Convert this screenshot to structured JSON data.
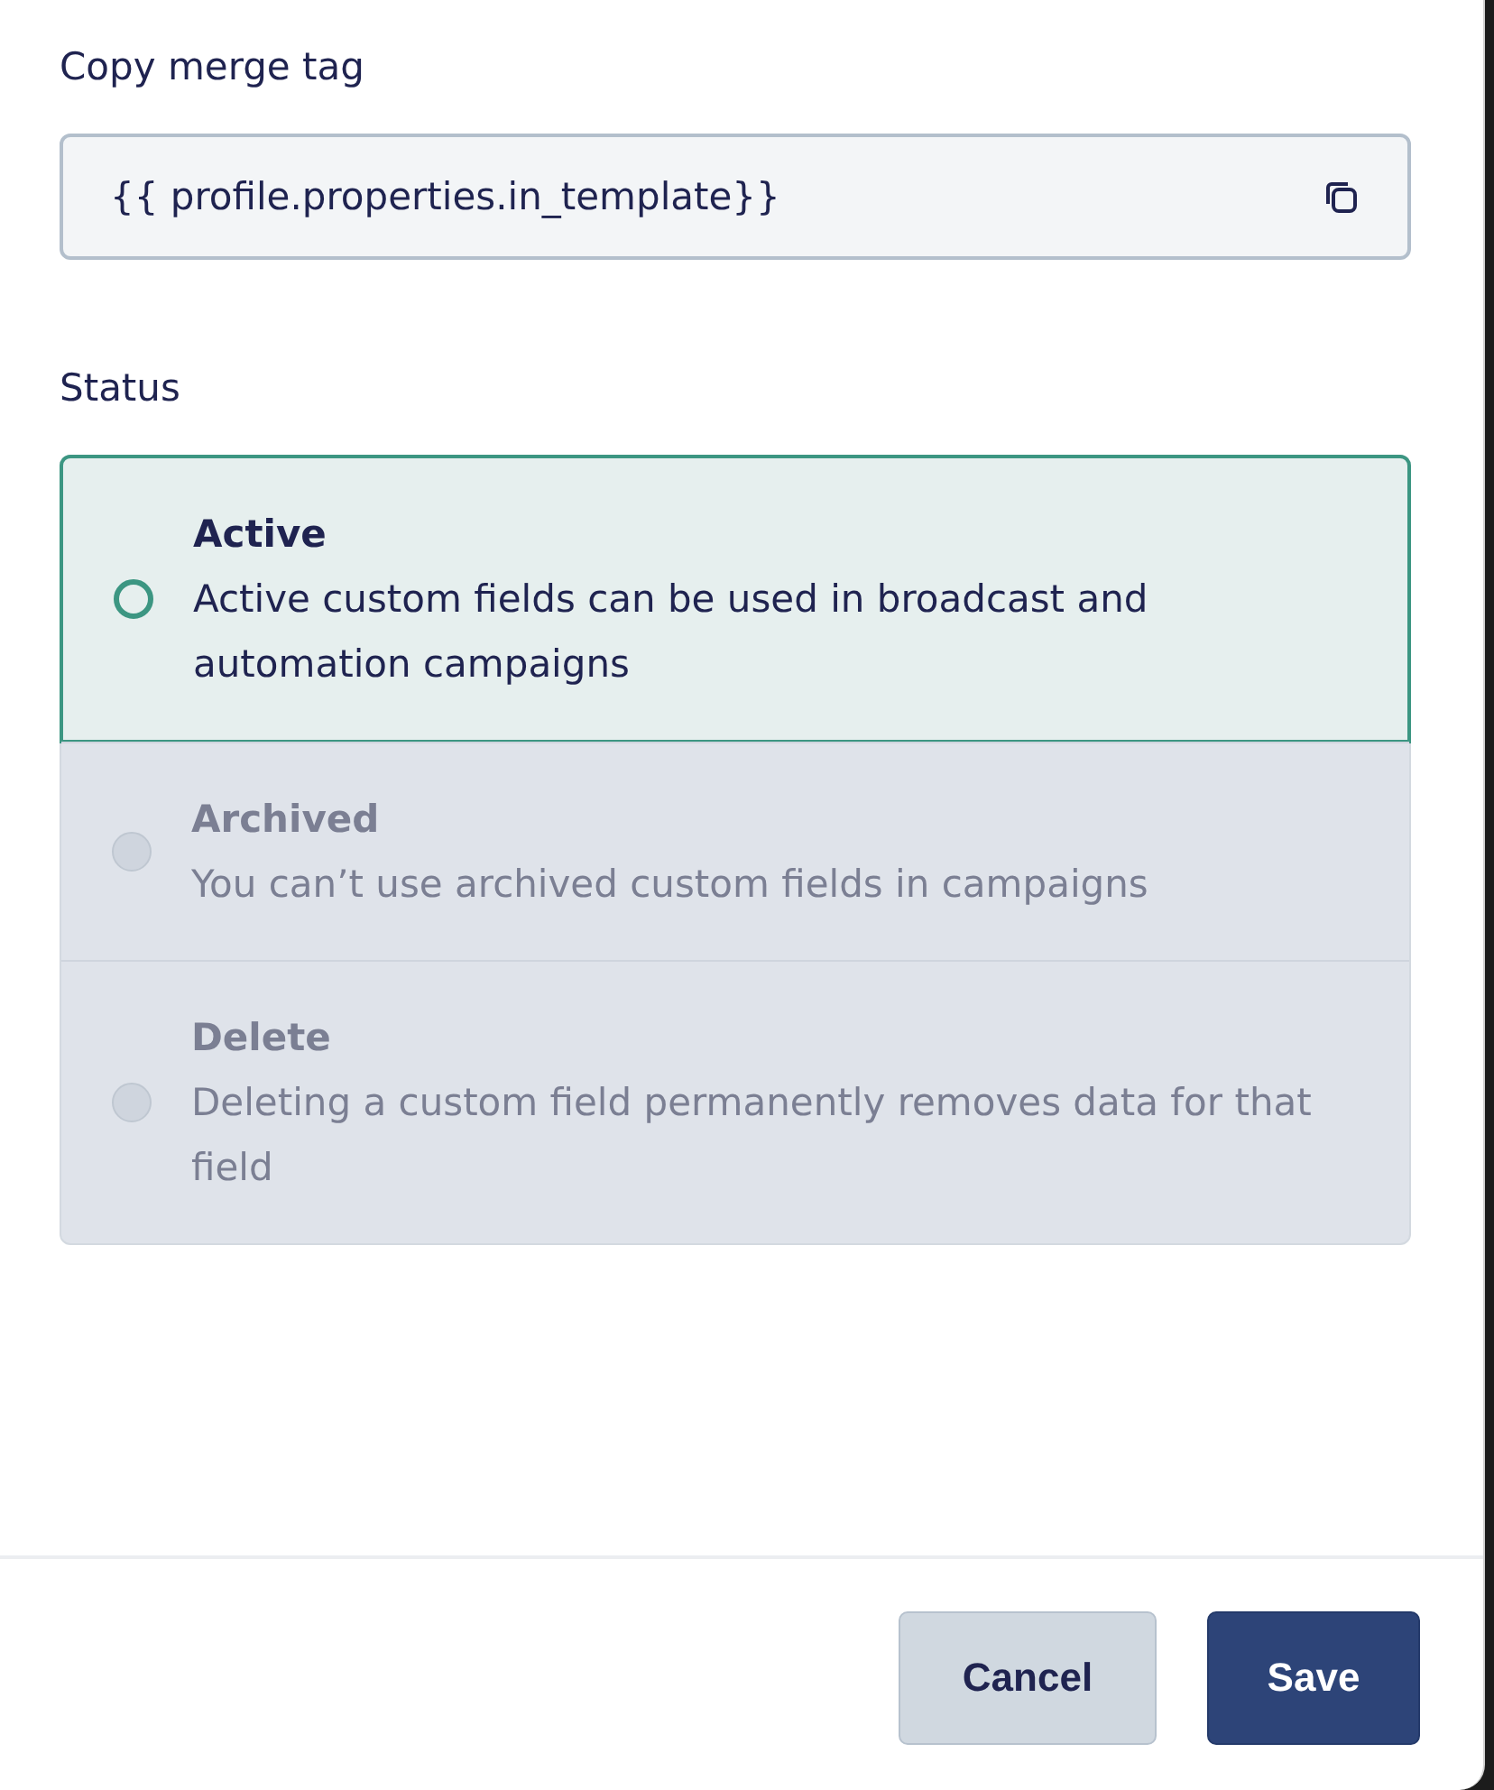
{
  "merge_tag": {
    "label": "Copy merge tag",
    "value": "{{ profile.properties.in_template}}"
  },
  "status": {
    "label": "Status",
    "options": [
      {
        "title": "Active",
        "description": "Active custom fields can be used in broadcast and automation campaigns",
        "selected": true,
        "disabled": false
      },
      {
        "title": "Archived",
        "description": "You can’t use archived custom fields in campaigns",
        "selected": false,
        "disabled": true
      },
      {
        "title": "Delete",
        "description": "Deleting a custom field permanently removes data for that field",
        "selected": false,
        "disabled": true
      }
    ]
  },
  "buttons": [
    {
      "label": "Cancel",
      "kind": "secondary"
    },
    {
      "label": "Save",
      "kind": "primary"
    }
  ]
}
